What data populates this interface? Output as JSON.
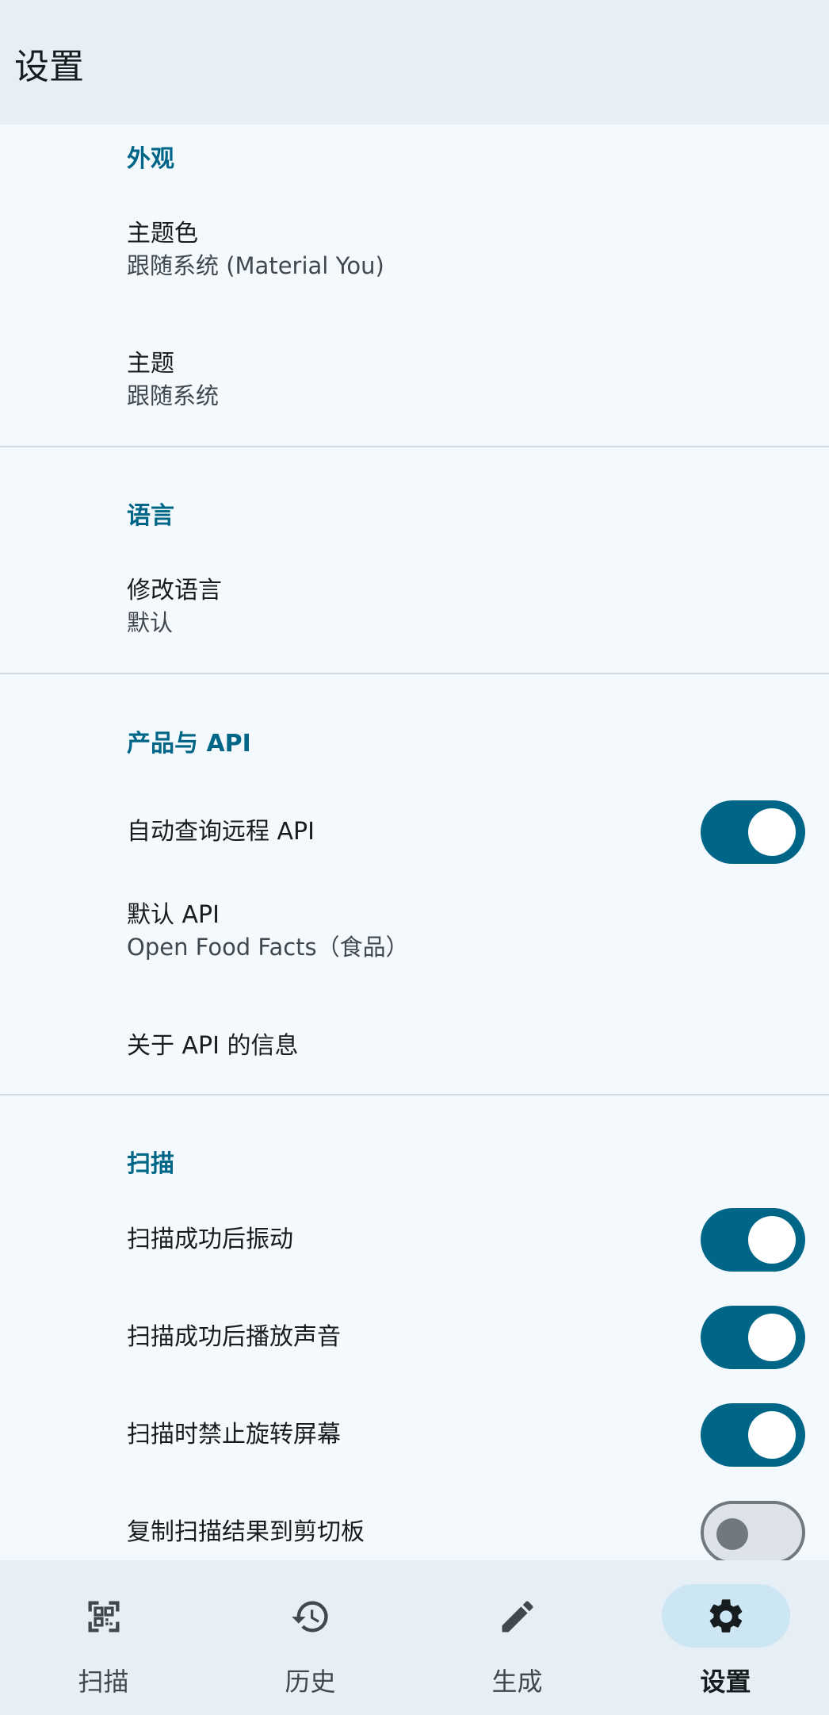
{
  "header": {
    "title": "设置"
  },
  "appearance": {
    "heading": "外观",
    "theme_color": {
      "title": "主题色",
      "subtitle": "跟随系统 (Material You)"
    },
    "theme": {
      "title": "主题",
      "subtitle": "跟随系统"
    }
  },
  "language": {
    "heading": "语言",
    "change_language": {
      "title": "修改语言",
      "subtitle": "默认"
    }
  },
  "products_api": {
    "heading": "产品与 API",
    "auto_query": {
      "title": "自动查询远程 API",
      "enabled": true
    },
    "default_api": {
      "title": "默认 API",
      "subtitle": "Open Food Facts（食品）"
    },
    "about_api": {
      "title": "关于 API 的信息"
    }
  },
  "scan": {
    "heading": "扫描",
    "vibrate": {
      "title": "扫描成功后振动",
      "enabled": true
    },
    "sound": {
      "title": "扫描成功后播放声音",
      "enabled": true
    },
    "lock_rotation": {
      "title": "扫描时禁止旋转屏幕",
      "enabled": true
    },
    "copy_clipboard": {
      "title": "复制扫描结果到剪切板",
      "enabled": false
    }
  },
  "bottom_nav": {
    "items": [
      {
        "label": "扫描",
        "icon": "qr-code-scan-icon",
        "active": false
      },
      {
        "label": "历史",
        "icon": "history-icon",
        "active": false
      },
      {
        "label": "生成",
        "icon": "pencil-icon",
        "active": false
      },
      {
        "label": "设置",
        "icon": "gear-icon",
        "active": true
      }
    ]
  },
  "colors": {
    "accent": "#006687",
    "background": "#f4f9fd",
    "bar": "#e6eff6",
    "active_pill": "#cde6f4"
  }
}
